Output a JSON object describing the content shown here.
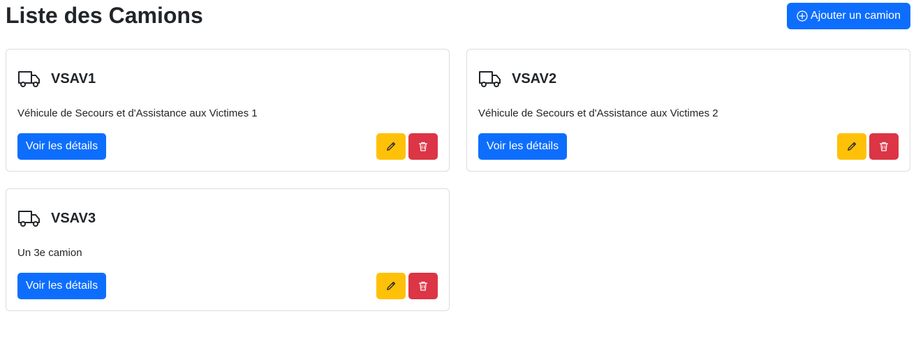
{
  "page": {
    "title": "Liste des Camions"
  },
  "toolbar": {
    "add_label": "Ajouter un camion",
    "add_icon": "plus-circle-icon"
  },
  "colors": {
    "primary": "#0d6efd",
    "warning": "#ffc107",
    "danger": "#dc3545",
    "border": "#d9dcdf",
    "text": "#212529"
  },
  "trucks": [
    {
      "name": "VSAV1",
      "description": "Véhicule de Secours et d'Assistance aux Victimes 1",
      "details_label": "Voir les détails",
      "icon": "truck-icon"
    },
    {
      "name": "VSAV2",
      "description": "Véhicule de Secours et d'Assistance aux Victimes 2",
      "details_label": "Voir les détails",
      "icon": "truck-icon"
    },
    {
      "name": "VSAV3",
      "description": "Un 3e camion",
      "details_label": "Voir les détails",
      "icon": "truck-icon"
    }
  ]
}
